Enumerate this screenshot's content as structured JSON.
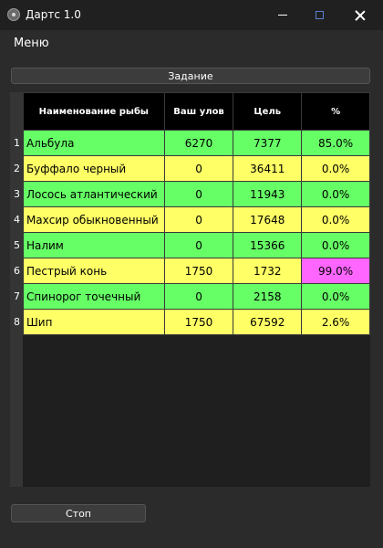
{
  "window": {
    "title": "Дартс 1.0"
  },
  "menu": {
    "label": "Меню"
  },
  "task_button": "Задание",
  "stop_button": "Стоп",
  "table": {
    "headers": [
      "Наименование рыбы",
      "Ваш улов",
      "Цель",
      "%"
    ],
    "rows": [
      {
        "n": "1",
        "name": "Альбула",
        "catch": "6270",
        "target": "7377",
        "pct": "85.0%",
        "row_color": "green",
        "pct_color": "green"
      },
      {
        "n": "2",
        "name": "Буффало черный",
        "catch": "0",
        "target": "36411",
        "pct": "0.0%",
        "row_color": "yellow",
        "pct_color": "yellow"
      },
      {
        "n": "3",
        "name": "Лосось атлантический",
        "catch": "0",
        "target": "11943",
        "pct": "0.0%",
        "row_color": "green",
        "pct_color": "green"
      },
      {
        "n": "4",
        "name": "Махсир обыкновенный",
        "catch": "0",
        "target": "17648",
        "pct": "0.0%",
        "row_color": "yellow",
        "pct_color": "yellow"
      },
      {
        "n": "5",
        "name": "Налим",
        "catch": "0",
        "target": "15366",
        "pct": "0.0%",
        "row_color": "green",
        "pct_color": "green"
      },
      {
        "n": "6",
        "name": "Пестрый конь",
        "catch": "1750",
        "target": "1732",
        "pct": "99.0%",
        "row_color": "yellow",
        "pct_color": "magenta"
      },
      {
        "n": "7",
        "name": "Спинорог точечный",
        "catch": "0",
        "target": "2158",
        "pct": "0.0%",
        "row_color": "green",
        "pct_color": "green"
      },
      {
        "n": "8",
        "name": "Шип",
        "catch": "1750",
        "target": "67592",
        "pct": "2.6%",
        "row_color": "yellow",
        "pct_color": "yellow"
      }
    ]
  },
  "colors": {
    "green": "#66ff66",
    "yellow": "#ffff66",
    "magenta": "#ff66ff",
    "header_bg": "#000000",
    "window_bg": "#2b2b2b"
  },
  "icons": {
    "app": "app-icon",
    "minimize": "minimize-icon",
    "maximize": "maximize-icon",
    "close": "close-icon"
  }
}
